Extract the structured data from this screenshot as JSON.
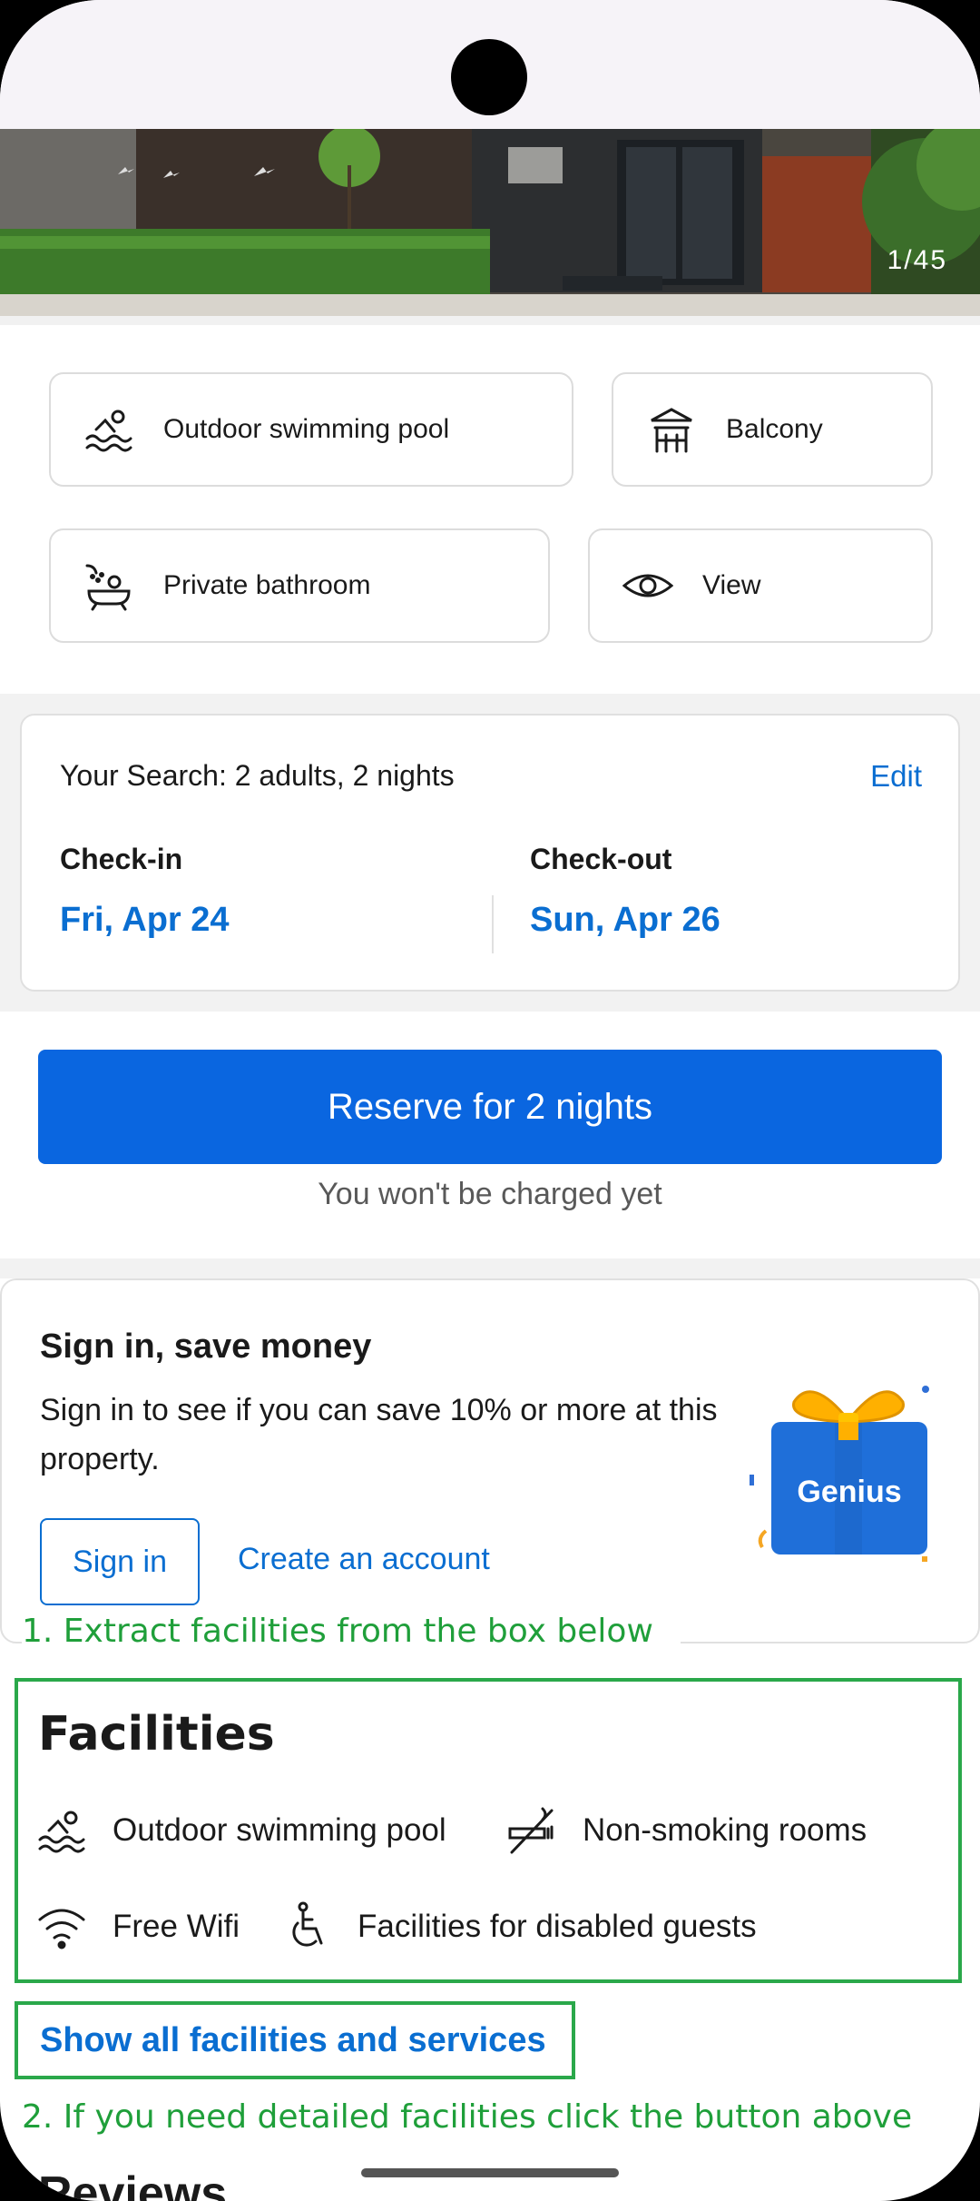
{
  "hero": {
    "counter": "1/45"
  },
  "amenities": [
    {
      "label": "Outdoor swimming pool",
      "icon": "swimming-pool-icon"
    },
    {
      "label": "Balcony",
      "icon": "balcony-icon"
    },
    {
      "label": "Private bathroom",
      "icon": "bathtub-icon"
    },
    {
      "label": "View",
      "icon": "eye-icon"
    }
  ],
  "search": {
    "summary": "Your Search: 2 adults, 2 nights",
    "edit_label": "Edit",
    "checkin_label": "Check-in",
    "checkin_date": "Fri, Apr 24",
    "checkout_label": "Check-out",
    "checkout_date": "Sun, Apr 26"
  },
  "reserve": {
    "button_label": "Reserve for 2 nights",
    "note": "You won't be charged yet"
  },
  "signin": {
    "title": "Sign in, save money",
    "body": "Sign in to see if you can save 10% or more at this property.",
    "signin_label": "Sign in",
    "create_label": "Create an account",
    "badge_text": "Genius"
  },
  "annotations": {
    "first": "1. Extract facilities from the box below",
    "second": "2. If you need detailed facilities click the button above"
  },
  "facilities": {
    "title": "Facilities",
    "items": [
      {
        "label": "Outdoor swimming pool",
        "icon": "swimming-pool-icon"
      },
      {
        "label": "Non-smoking rooms",
        "icon": "no-smoking-icon"
      },
      {
        "label": "Free Wifi",
        "icon": "wifi-icon"
      },
      {
        "label": "Facilities for disabled guests",
        "icon": "wheelchair-icon"
      }
    ],
    "show_all_label": "Show all facilities and services"
  },
  "next_section": {
    "title": "Reviews"
  },
  "colors": {
    "accent": "#0a6ed1",
    "primary_button": "#0a66e0",
    "annotation": "#2aa84a"
  }
}
